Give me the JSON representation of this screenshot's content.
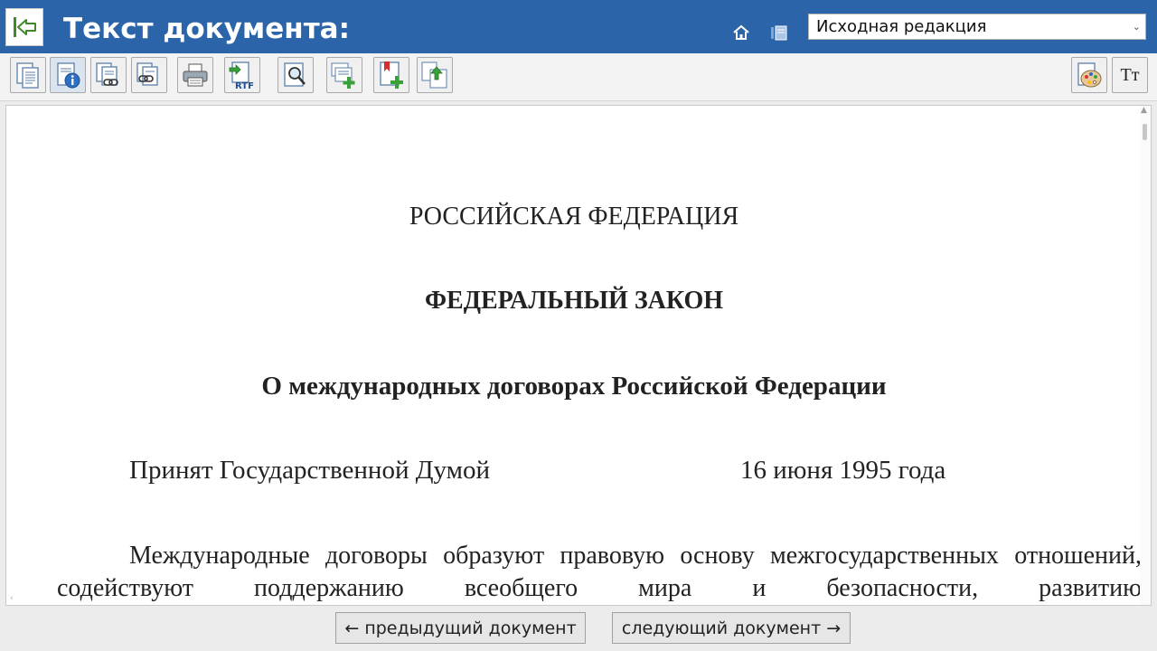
{
  "header": {
    "title": "Текст документа:",
    "edition_select": {
      "value": "Исходная редакция"
    },
    "colors": {
      "bar": "#2b64a8"
    }
  },
  "toolbar": {
    "buttons": [
      {
        "icon": "document-text-icon"
      },
      {
        "icon": "document-info-icon"
      },
      {
        "icon": "document-links-icon"
      },
      {
        "icon": "document-links-alt-icon"
      },
      {
        "icon": "print-icon"
      },
      {
        "icon": "export-rtf-icon",
        "badge": "RTF"
      },
      {
        "icon": "search-document-icon"
      },
      {
        "icon": "add-to-folder-icon"
      },
      {
        "icon": "add-bookmark-icon"
      },
      {
        "icon": "structure-icon"
      },
      {
        "icon": "color-palette-icon"
      },
      {
        "icon": "font-size-icon",
        "label": "Tт"
      }
    ]
  },
  "document": {
    "country": "РОССИЙСКАЯ ФЕДЕРАЦИЯ",
    "law_type": "ФЕДЕРАЛЬНЫЙ ЗАКОН",
    "law_title": "О международных договорах Российской Федерации",
    "adopted_by": "Принят Государственной Думой",
    "adopted_date": "16 июня 1995 года",
    "preamble": "Международные договоры образуют правовую основу межгосударственных отношений, содействуют поддержанию всеобщего мира и безопасности, развитию"
  },
  "footer": {
    "prev_label": "← предыдущий документ",
    "next_label": "следующий документ →"
  }
}
